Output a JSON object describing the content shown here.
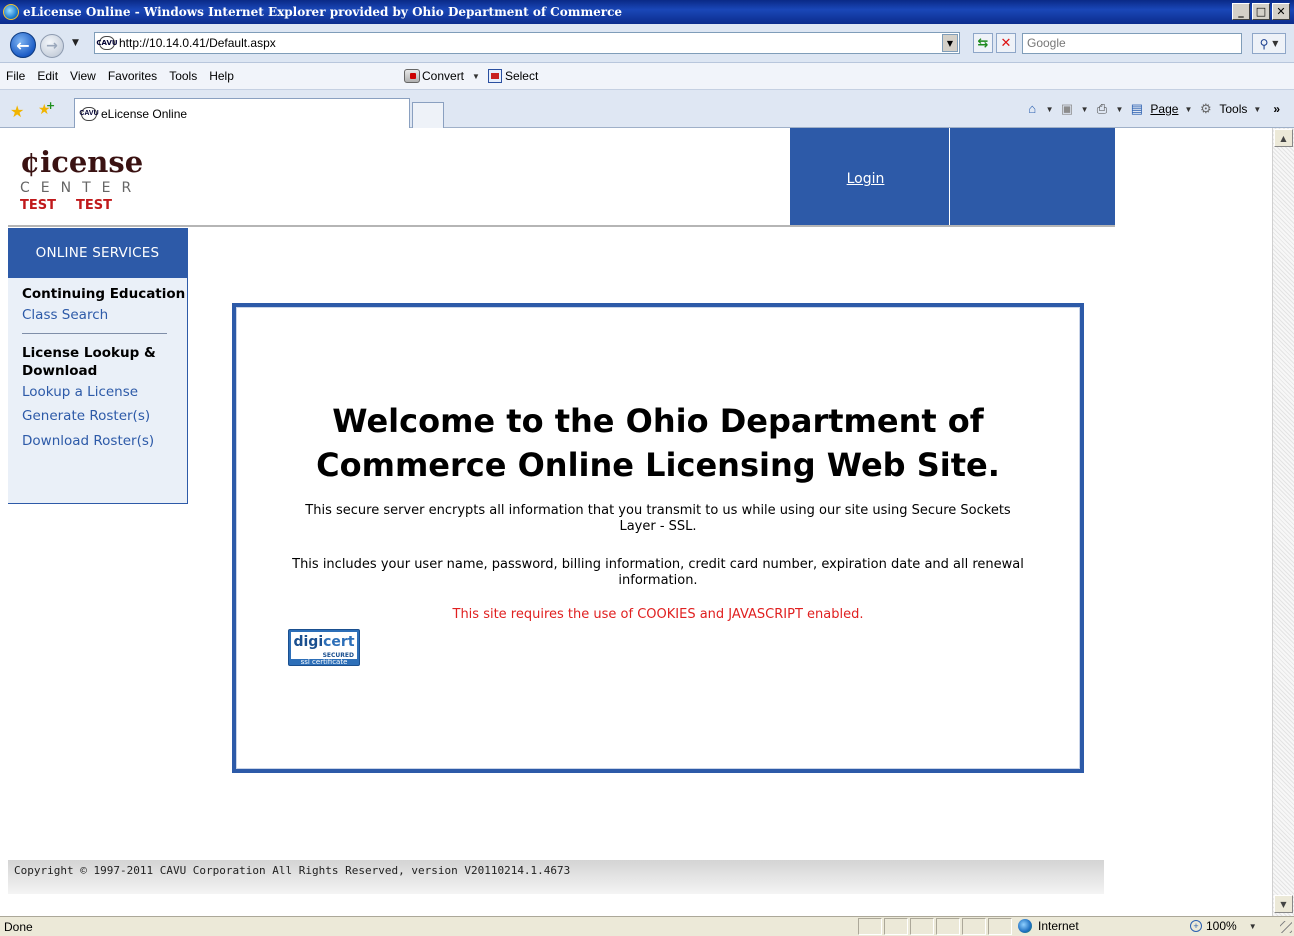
{
  "window": {
    "title": "eLicense Online - Windows Internet Explorer provided by Ohio Department of Commerce",
    "controls": [
      "_",
      "□",
      "✕"
    ]
  },
  "address": {
    "url": "http://10.14.0.41/Default.aspx",
    "search_placeholder": "Google"
  },
  "menu": {
    "items": [
      {
        "label": "File"
      },
      {
        "label": "Edit"
      },
      {
        "label": "View"
      },
      {
        "label": "Favorites"
      },
      {
        "label": "Tools"
      },
      {
        "label": "Help"
      }
    ],
    "convert_label": "Convert",
    "select_label": "Select"
  },
  "tabs": {
    "active_tab": "eLicense Online",
    "page_label": "Page",
    "tools_label": "Tools"
  },
  "site": {
    "logo_word": "¢icense",
    "logo_sub": "CENTER",
    "logo_test_1": "TEST",
    "logo_test_2": "TEST",
    "login_label": "Login"
  },
  "sidenav": {
    "header": "ONLINE SERVICES",
    "section1": "Continuing Education",
    "class_search": "Class Search",
    "section2": "License Lookup & Download",
    "lookup": "Lookup a License",
    "generate": "Generate Roster(s)",
    "download": "Download Roster(s)"
  },
  "welcome": {
    "title": "Welcome to the Ohio Department of Commerce Online Licensing Web Site.",
    "para1": "This secure server encrypts all information that you transmit to us while using our site using Secure Sockets Layer - SSL.",
    "para2": "This includes your user name, password, billing information, credit card number, expiration date and all renewal information.",
    "warning": "This site requires the use of COOKIES and JAVASCRIPT enabled.",
    "warning_color": "#e02020",
    "badge_word_1": "digi",
    "badge_word_2": "cert",
    "badge_secured": "SECURED",
    "badge_sub": "ssl certificate"
  },
  "footer": {
    "copyright": "Copyright © 1997-2011 CAVU Corporation All Rights Reserved, version V20110214.1.4673"
  },
  "status": {
    "text": "Done",
    "zone": "Internet",
    "zoom": "100%"
  },
  "colors": {
    "brand_blue": "#2d5aa8",
    "logo_red": "#c0191b"
  }
}
